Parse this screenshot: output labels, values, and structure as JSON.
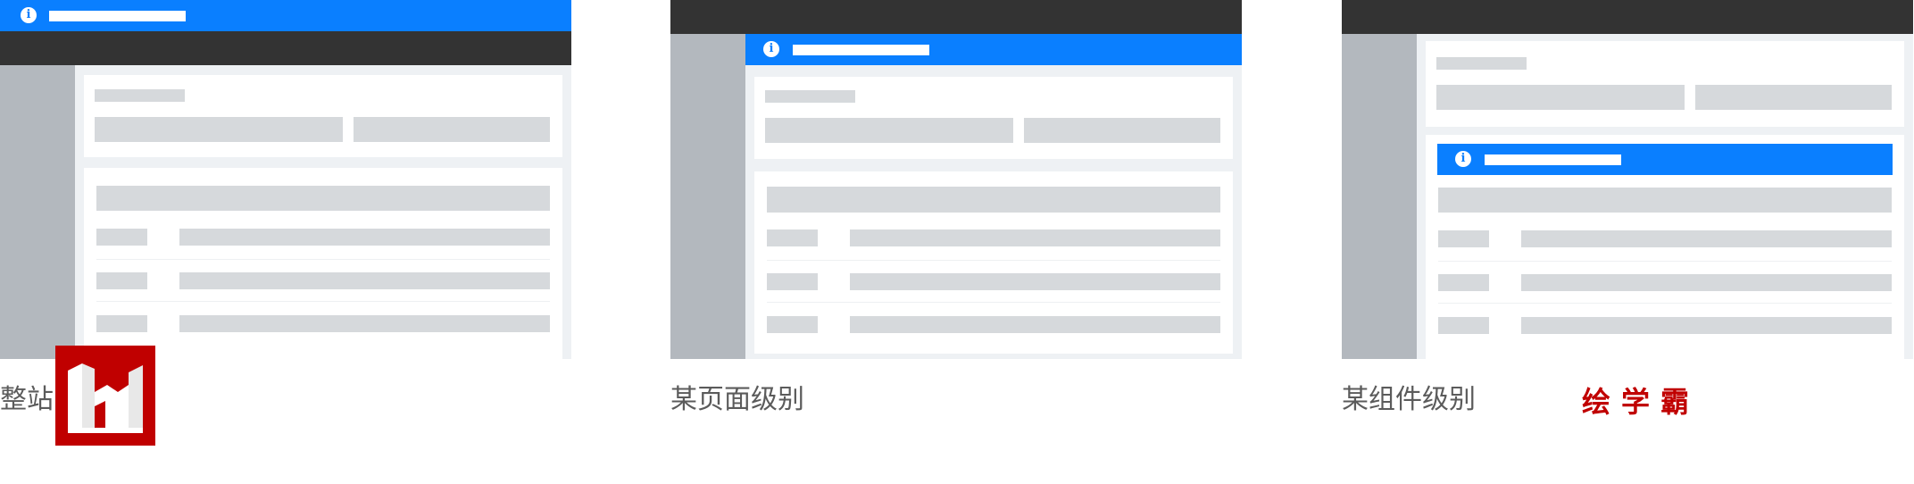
{
  "captions": {
    "site": "整站",
    "page": "某页面级别",
    "component": "某组件级别"
  },
  "notice_icon": "info-icon",
  "notice_glyph": "i",
  "watermark": {
    "brand": "绘学霸",
    "logo_color": "#c00000"
  },
  "colors": {
    "notice_blue": "#0a7fff",
    "topbar": "#333333",
    "sidebar": "#b3b8be",
    "content_bg": "#eef1f4",
    "skeleton": "#d6d9dc"
  }
}
